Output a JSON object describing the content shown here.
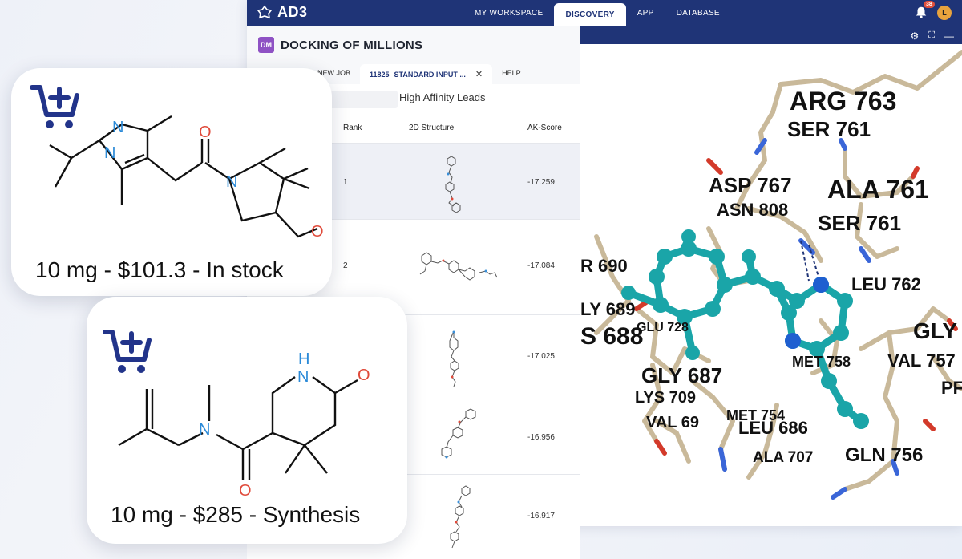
{
  "app": {
    "brand": "AD3",
    "nav": [
      "MY WORKSPACE",
      "DISCOVERY",
      "APP",
      "DATABASE"
    ],
    "active_nav": "DISCOVERY",
    "notifications": "38",
    "avatar_initial": "L"
  },
  "page": {
    "badge": "DM",
    "title": "DOCKING OF MILLIONS",
    "tabs": {
      "new_job": "NEW JOB",
      "job_id": "11825",
      "job_label": "STANDARD INPUT ...",
      "help": "HELP"
    },
    "filter": "High Affinity Leads"
  },
  "table": {
    "columns": [
      "Rank",
      "2D Structure",
      "AK-Score"
    ],
    "rows": [
      {
        "rank": "1",
        "score": "-17.259"
      },
      {
        "rank": "2",
        "score": "-17.084"
      },
      {
        "rank": "",
        "score": "-17.025"
      },
      {
        "rank": "",
        "score": "-16.956"
      },
      {
        "rank": "",
        "score": "-16.917"
      }
    ]
  },
  "viewer_labels": [
    "ARG 763",
    "SER 761",
    "ASP 767",
    "ALA 761",
    "ASN 808",
    "SER 761",
    "LEU 762",
    "R 690",
    "LY 689",
    "S 688",
    "GLU 728",
    "GLY 687",
    "GLY",
    "VAL 757",
    "MET 758",
    "LYS 709",
    "VAL 69",
    "MET 754",
    "LEU 686",
    "ALA 707",
    "GLN 756",
    "PF"
  ],
  "products": [
    {
      "price_label": "10 mg - $101.3 - In stock"
    },
    {
      "price_label": "10 mg - $285 - Synthesis"
    }
  ],
  "colors": {
    "nav_bg": "#1f3477",
    "accent": "#8f52c4",
    "cart": "#22348a",
    "ligand": "#1aa5a8"
  }
}
